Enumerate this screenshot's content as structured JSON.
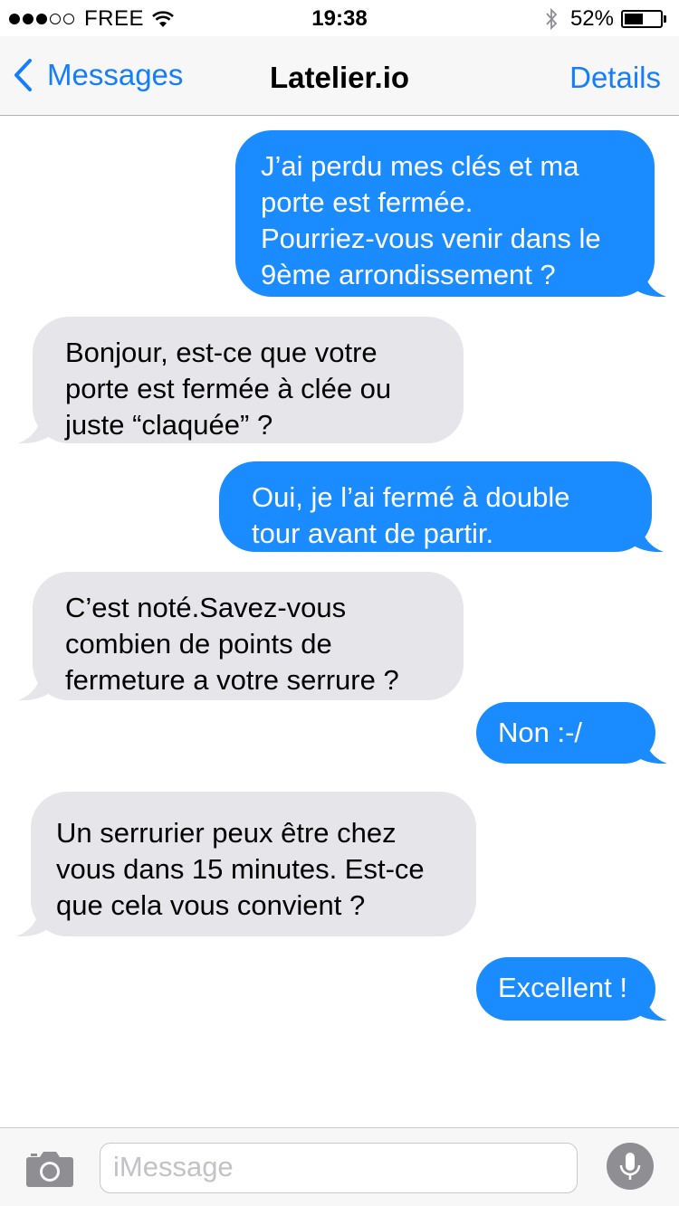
{
  "status_bar": {
    "signal": {
      "filled": 3,
      "total": 5
    },
    "carrier": "FREE",
    "time": "19:38",
    "battery_text": "52%",
    "battery_level": 0.52
  },
  "nav": {
    "back_label": "Messages",
    "title": "Latelier.io",
    "details_label": "Details",
    "accent_color": "#157efb"
  },
  "messages": [
    {
      "direction": "outgoing",
      "text": "J’ai perdu mes clés et ma\nporte est fermée.\nPourriez-vous venir dans le\n9ème arrondissement ?"
    },
    {
      "direction": "incoming",
      "text": "Bonjour, est-ce que votre\nporte est fermée à clée ou\njuste “claquée” ?"
    },
    {
      "direction": "outgoing",
      "text": "Oui, je l’ai fermé à double\ntour avant de partir."
    },
    {
      "direction": "incoming",
      "text": "C’est noté.Savez-vous\ncombien de points de\nfermeture a votre serrure ?"
    },
    {
      "direction": "outgoing",
      "text": "Non :-/"
    },
    {
      "direction": "incoming",
      "text": "Un serrurier peux être chez\nvous dans 15 minutes. Est-ce\nque cela vous convient ?"
    },
    {
      "direction": "outgoing",
      "text": "Excellent !"
    }
  ],
  "input": {
    "placeholder": "iMessage",
    "icons": {
      "left": "camera-icon",
      "right": "microphone-icon"
    }
  },
  "colors": {
    "outgoing_bubble": "#1a8cff",
    "incoming_bubble": "#e5e5ea"
  }
}
